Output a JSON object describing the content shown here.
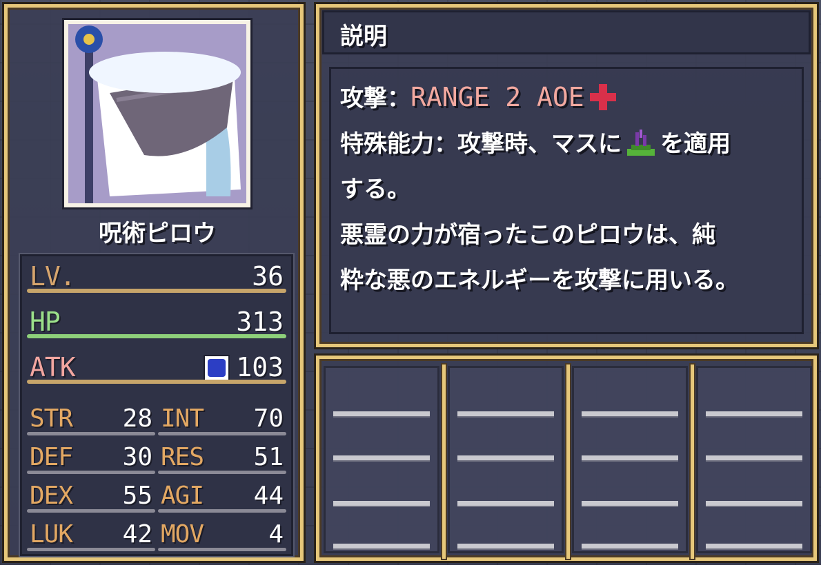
{
  "unit": {
    "name": "呪術ピロウ",
    "portrait_icon": "pillow-sorcerer-portrait"
  },
  "stats": {
    "lv": {
      "label": "LV.",
      "value": "36"
    },
    "hp": {
      "label": "HP",
      "value": "313"
    },
    "atk": {
      "label": "ATK",
      "value": "103",
      "icon": "magic-damage-icon"
    },
    "sub": [
      {
        "label": "STR",
        "value": "28"
      },
      {
        "label": "INT",
        "value": "70"
      },
      {
        "label": "DEF",
        "value": "30"
      },
      {
        "label": "RES",
        "value": "51"
      },
      {
        "label": "DEX",
        "value": "55"
      },
      {
        "label": "AGI",
        "value": "44"
      },
      {
        "label": "LUK",
        "value": "42"
      },
      {
        "label": "MOV",
        "value": "4"
      }
    ]
  },
  "description": {
    "title": "説明",
    "attack_prefix": "攻撃：",
    "attack_range": "RANGE 2 AOE",
    "special_prefix": "特殊能力：攻撃時、マスに",
    "special_suffix": "を適用",
    "special_line2": "する。",
    "flavor_line1": "悪霊の力が宿ったこのピロウは、純",
    "flavor_line2": "粋な悪のエネルギーを攻撃に用いる。"
  },
  "colors": {
    "frame_gold": "#e6c77a",
    "range_text": "#f3a9a0",
    "hp_bar": "#8ed07a",
    "stat_label": "#e3a863"
  }
}
